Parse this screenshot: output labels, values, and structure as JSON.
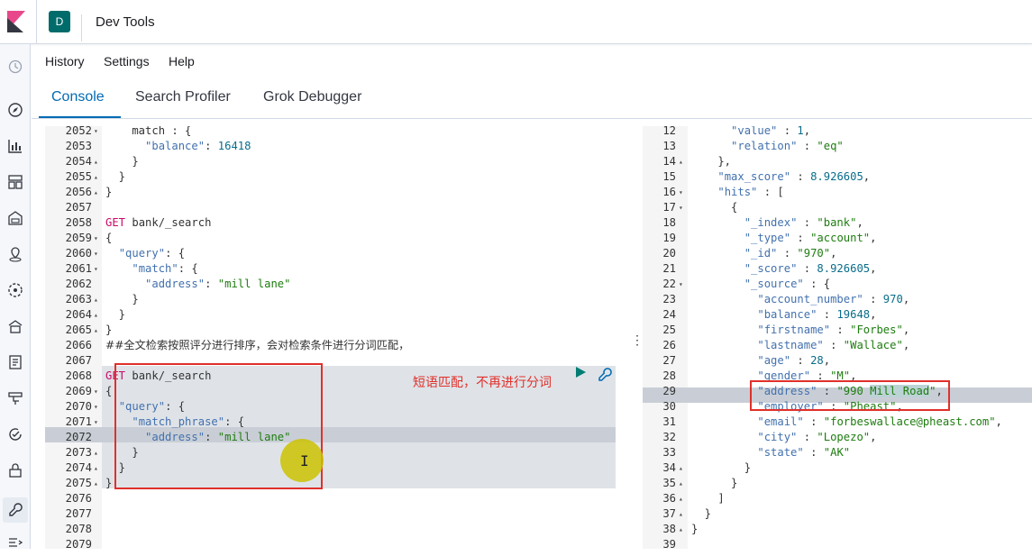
{
  "header": {
    "space_initial": "D",
    "app_title": "Dev Tools"
  },
  "menu": {
    "history": "History",
    "settings": "Settings",
    "help": "Help"
  },
  "tabs": [
    {
      "label": "Console",
      "active": true
    },
    {
      "label": "Search Profiler",
      "active": false
    },
    {
      "label": "Grok Debugger",
      "active": false
    }
  ],
  "sidenav": {
    "icons": [
      "clock-icon",
      "compass-icon",
      "visualize-icon",
      "dashboard-icon",
      "canvas-icon",
      "maps-icon",
      "ml-icon",
      "infra-icon",
      "logs-icon",
      "apm-icon",
      "uptime-icon",
      "security-icon",
      "devtools-icon",
      "collapse-icon"
    ]
  },
  "editor": {
    "lines": [
      {
        "n": "2052",
        "fold": "▾",
        "code": "    match : {"
      },
      {
        "n": "2053",
        "fold": "",
        "code": "      \"balance\": 16418"
      },
      {
        "n": "2054",
        "fold": "▴",
        "code": "    }"
      },
      {
        "n": "2055",
        "fold": "▴",
        "code": "  }"
      },
      {
        "n": "2056",
        "fold": "▴",
        "code": "}"
      },
      {
        "n": "2057",
        "fold": "",
        "code": ""
      },
      {
        "n": "2058",
        "fold": "",
        "code": "GET bank/_search"
      },
      {
        "n": "2059",
        "fold": "▾",
        "code": "{"
      },
      {
        "n": "2060",
        "fold": "▾",
        "code": "  \"query\": {"
      },
      {
        "n": "2061",
        "fold": "▾",
        "code": "    \"match\": {"
      },
      {
        "n": "2062",
        "fold": "",
        "code": "      \"address\": \"mill lane\""
      },
      {
        "n": "2063",
        "fold": "▴",
        "code": "    }"
      },
      {
        "n": "2064",
        "fold": "▴",
        "code": "  }"
      },
      {
        "n": "2065",
        "fold": "▴",
        "code": "}"
      },
      {
        "n": "2066",
        "fold": "",
        "code": "##全文检索按照评分进行排序，会对检索条件进行分词匹配，"
      },
      {
        "n": "2067",
        "fold": "",
        "code": ""
      },
      {
        "n": "2068",
        "fold": "",
        "code": "GET bank/_search"
      },
      {
        "n": "2069",
        "fold": "▾",
        "code": "{"
      },
      {
        "n": "2070",
        "fold": "▾",
        "code": "  \"query\": {"
      },
      {
        "n": "2071",
        "fold": "▾",
        "code": "    \"match_phrase\": {"
      },
      {
        "n": "2072",
        "fold": "",
        "code": "      \"address\": \"mill lane\""
      },
      {
        "n": "2073",
        "fold": "▴",
        "code": "    }"
      },
      {
        "n": "2074",
        "fold": "▴",
        "code": "  }"
      },
      {
        "n": "2075",
        "fold": "▴",
        "code": "}"
      },
      {
        "n": "2076",
        "fold": "",
        "code": ""
      },
      {
        "n": "2077",
        "fold": "",
        "code": ""
      },
      {
        "n": "2078",
        "fold": "",
        "code": ""
      },
      {
        "n": "2079",
        "fold": "",
        "code": ""
      }
    ],
    "annotation": "短语匹配，不再进行分词"
  },
  "output": {
    "lines": [
      {
        "n": "12",
        "fold": "",
        "code": "      \"value\" : 1,"
      },
      {
        "n": "13",
        "fold": "",
        "code": "      \"relation\" : \"eq\""
      },
      {
        "n": "14",
        "fold": "▴",
        "code": "    },"
      },
      {
        "n": "15",
        "fold": "",
        "code": "    \"max_score\" : 8.926605,"
      },
      {
        "n": "16",
        "fold": "▾",
        "code": "    \"hits\" : ["
      },
      {
        "n": "17",
        "fold": "▾",
        "code": "      {"
      },
      {
        "n": "18",
        "fold": "",
        "code": "        \"_index\" : \"bank\","
      },
      {
        "n": "19",
        "fold": "",
        "code": "        \"_type\" : \"account\","
      },
      {
        "n": "20",
        "fold": "",
        "code": "        \"_id\" : \"970\","
      },
      {
        "n": "21",
        "fold": "",
        "code": "        \"_score\" : 8.926605,"
      },
      {
        "n": "22",
        "fold": "▾",
        "code": "        \"_source\" : {"
      },
      {
        "n": "23",
        "fold": "",
        "code": "          \"account_number\" : 970,"
      },
      {
        "n": "24",
        "fold": "",
        "code": "          \"balance\" : 19648,"
      },
      {
        "n": "25",
        "fold": "",
        "code": "          \"firstname\" : \"Forbes\","
      },
      {
        "n": "26",
        "fold": "",
        "code": "          \"lastname\" : \"Wallace\","
      },
      {
        "n": "27",
        "fold": "",
        "code": "          \"age\" : 28,"
      },
      {
        "n": "28",
        "fold": "",
        "code": "          \"gender\" : \"M\","
      },
      {
        "n": "29",
        "fold": "",
        "code": "          \"address\" : \"990 Mill Road\","
      },
      {
        "n": "30",
        "fold": "",
        "code": "          \"employer\" : \"Pheast\","
      },
      {
        "n": "31",
        "fold": "",
        "code": "          \"email\" : \"forbeswallace@pheast.com\","
      },
      {
        "n": "32",
        "fold": "",
        "code": "          \"city\" : \"Lopezo\","
      },
      {
        "n": "33",
        "fold": "",
        "code": "          \"state\" : \"AK\""
      },
      {
        "n": "34",
        "fold": "▴",
        "code": "        }"
      },
      {
        "n": "35",
        "fold": "▴",
        "code": "      }"
      },
      {
        "n": "36",
        "fold": "▴",
        "code": "    ]"
      },
      {
        "n": "37",
        "fold": "▴",
        "code": "  }"
      },
      {
        "n": "38",
        "fold": "▴",
        "code": "}"
      },
      {
        "n": "39",
        "fold": "",
        "code": ""
      }
    ]
  },
  "colors": {
    "accent": "#006bb4",
    "annotation_red": "#e0302a",
    "space_badge": "#006b6b"
  }
}
